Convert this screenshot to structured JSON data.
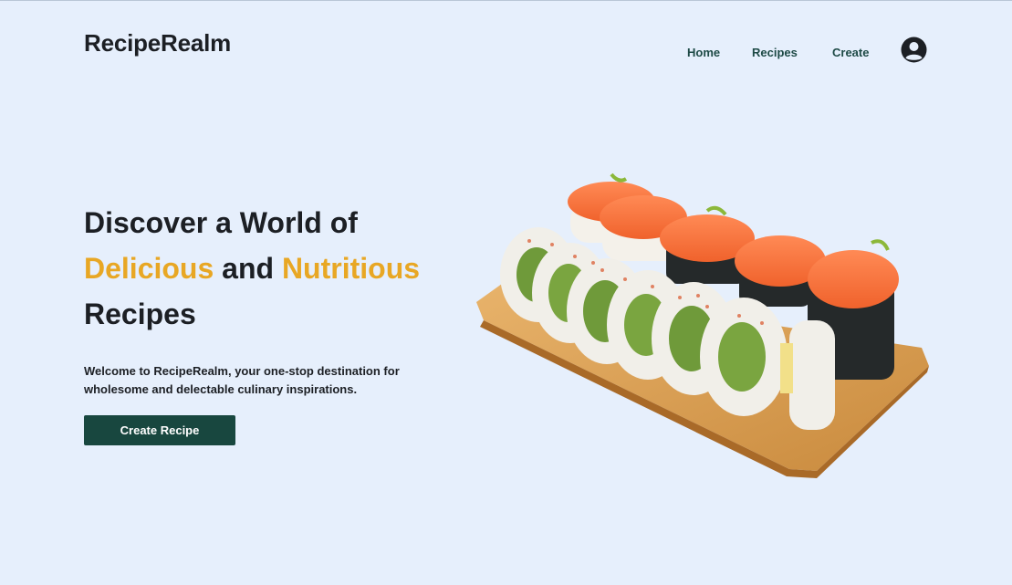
{
  "header": {
    "logo": "RecipeRealm",
    "nav": [
      {
        "label": "Home"
      },
      {
        "label": "Recipes"
      },
      {
        "label": "Create"
      }
    ]
  },
  "hero": {
    "title_line1": "Discover a World of",
    "title_accent1": "Delicious",
    "title_and": " and ",
    "title_accent2": "Nutritious",
    "title_line3": "Recipes",
    "description": "Welcome to RecipeRealm, your one-stop destination for wholesome and delectable culinary inspirations.",
    "cta_label": "Create Recipe"
  },
  "icons": {
    "avatar": "user-circle-icon"
  },
  "colors": {
    "background": "#e6effc",
    "accent": "#e8a724",
    "button": "#18473f",
    "nav_text": "#1e4a46"
  }
}
